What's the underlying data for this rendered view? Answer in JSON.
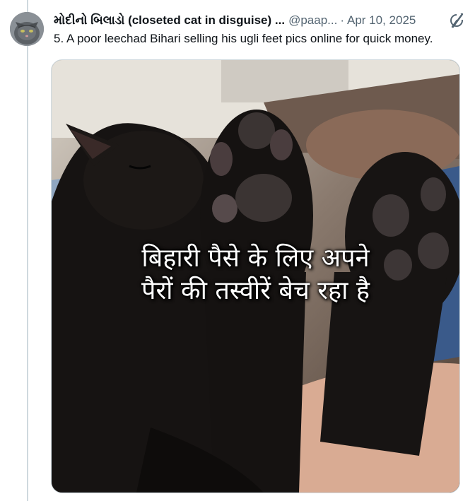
{
  "post": {
    "display_name": "મોદીનો બિલાડો (closeted cat in disguise) ...",
    "handle": "@paap...",
    "separator": "·",
    "date": "Apr 10, 2025",
    "text": "5. A poor leechad Bihari selling his ugli feet pics online for quick money."
  },
  "icons": {
    "avatar": "cat-avatar",
    "grok": "grok-icon"
  },
  "media": {
    "caption_line_1": "बिहारी पैसे के लिए अपने",
    "caption_line_2": "पैरों की तस्वीरें बेच रहा है"
  },
  "colors": {
    "text_primary": "#0f1419",
    "text_secondary": "#536471",
    "border": "#cfd9de"
  }
}
